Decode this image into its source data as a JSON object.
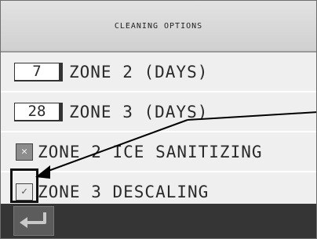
{
  "header": {
    "title": "CLEANING OPTIONS"
  },
  "rows": [
    {
      "value": "7",
      "label": "ZONE 2 (DAYS)"
    },
    {
      "value": "28",
      "label": "ZONE 3 (DAYS)"
    },
    {
      "label": "ZONE 2 ICE SANITIZING",
      "state": "x"
    },
    {
      "label": "ZONE 3 DESCALING",
      "state": "checked"
    }
  ],
  "footer": {
    "back_icon": "return-arrow-icon"
  },
  "colors": {
    "header_bg": "#d8d8d8",
    "row_bg": "#efefef",
    "footer_bg": "#353535",
    "text": "#2a2a2a"
  }
}
